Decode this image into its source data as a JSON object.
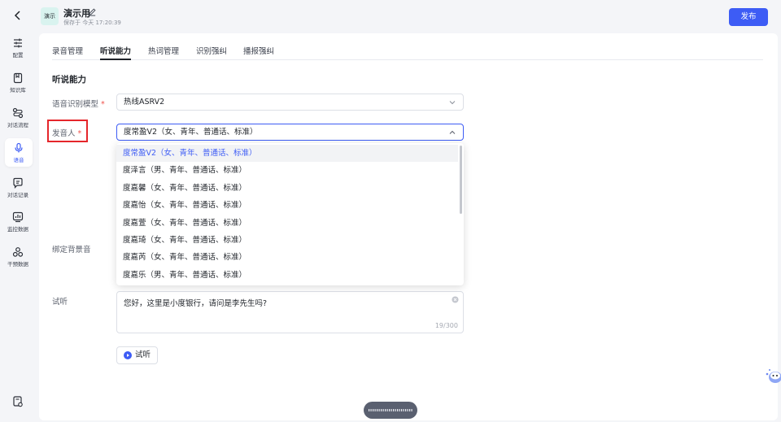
{
  "header": {
    "app_badge": "演示",
    "app_name": "演示用",
    "save_info": "保存于 今天 17:20:39",
    "publish_label": "发布"
  },
  "sidebar": {
    "items": [
      {
        "label": "配置",
        "icon": "sliders-icon"
      },
      {
        "label": "知识库",
        "icon": "knowledge-icon"
      },
      {
        "label": "对话流程",
        "icon": "flow-icon"
      },
      {
        "label": "语音",
        "icon": "mic-icon",
        "active": true
      },
      {
        "label": "对话记录",
        "icon": "chat-record-icon"
      },
      {
        "label": "监控数据",
        "icon": "monitor-icon"
      },
      {
        "label": "干预数据",
        "icon": "intervene-icon"
      }
    ]
  },
  "tabs": [
    {
      "label": "录音管理"
    },
    {
      "label": "听说能力",
      "active": true
    },
    {
      "label": "热词管理"
    },
    {
      "label": "识别强纠"
    },
    {
      "label": "播报强纠"
    }
  ],
  "section_title": "听说能力",
  "form": {
    "asr_model_label": "语音识别模型",
    "asr_model_value": "热线ASRV2",
    "speaker_label": "发音人",
    "speaker_value": "度常盈V2（女、青年、普通话、标准）",
    "required_mark": "*",
    "bg_sound_label": "绑定背景音",
    "preview_label": "试听",
    "preview_text": "您好，这里是小度银行，请问是李先生吗?",
    "preview_counter": "19/300",
    "listen_button": "试听"
  },
  "dropdown": {
    "options": [
      {
        "label": "度常盈V2（女、青年、普通话、标准）",
        "selected": true
      },
      {
        "label": "度泽言（男、青年、普通话、标准）"
      },
      {
        "label": "度嘉馨（女、青年、普通话、标准）"
      },
      {
        "label": "度嘉怡（女、青年、普通话、标准）"
      },
      {
        "label": "度嘉萱（女、青年、普通话、标准）"
      },
      {
        "label": "度嘉琦（女、青年、普通话、标准）"
      },
      {
        "label": "度嘉芮（女、青年、普通话、标准）"
      },
      {
        "label": "度嘉乐（男、青年、普通话、标准）"
      }
    ]
  },
  "colors": {
    "accent": "#3d5cf5",
    "required": "#f0524c",
    "highlight_box": "#e5262b"
  }
}
